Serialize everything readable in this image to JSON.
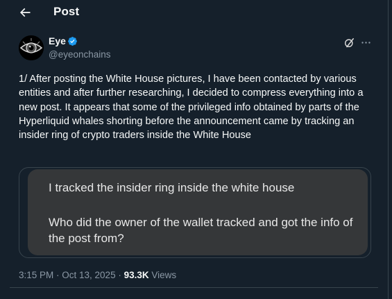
{
  "header": {
    "title": "Post",
    "back_icon": "arrow-left-icon"
  },
  "author": {
    "display_name": "Eye",
    "handle": "@eyeonchains",
    "verified": true,
    "verified_color": "#1d9bf0",
    "avatar_icon": "eye-avatar"
  },
  "actions": {
    "grok_icon": "grok-icon",
    "more_icon": "more-dots-icon"
  },
  "tweet": {
    "text": "1/ After posting the White House pictures, I have been contacted by various entities and after further researching, I decided to compress everything into a new post. It appears that some of the privileged info obtained by parts of the Hyperliquid whales shorting before the announcement came by tracking an insider ring of crypto traders inside the White House"
  },
  "media": {
    "line1": "I tracked the insider ring inside the white house",
    "line2": "Who did the owner of the wallet tracked and got the info of the post from?"
  },
  "meta": {
    "timestamp": "3:15 PM · Oct 13, 2025 · ",
    "views_count": "93.3K",
    "views_label": " Views"
  },
  "colors": {
    "background": "#15202b",
    "text": "#f7f9f9",
    "muted": "#8b98a5",
    "border": "#38444d"
  }
}
